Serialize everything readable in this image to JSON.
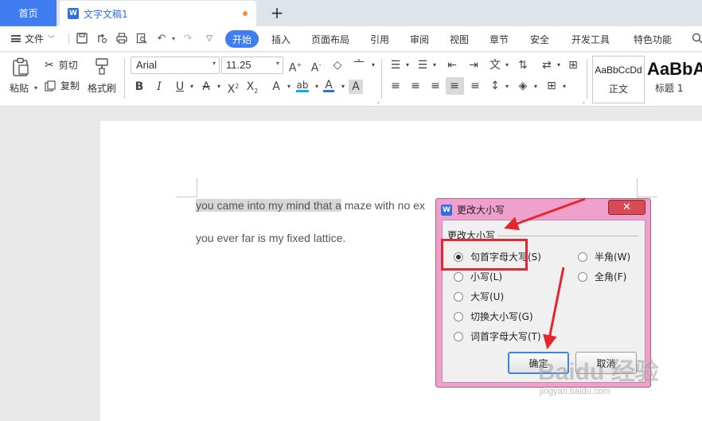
{
  "tabs": {
    "home": "首页",
    "doc_title": "文字文稿1",
    "add": "+"
  },
  "menubar": {
    "file": "文件",
    "items": [
      "插入",
      "页面布局",
      "引用",
      "审阅",
      "视图",
      "章节",
      "安全",
      "开发工具",
      "特色功能"
    ],
    "active": "开始"
  },
  "ribbon": {
    "paste": "粘贴",
    "cut": "剪切",
    "copy": "复制",
    "format_painter": "格式刷",
    "font_name": "Arial",
    "font_size": "11.25",
    "style_normal_sample": "AaBbCcDd",
    "style_normal_name": "正文",
    "style_heading_sample": "AaBbA",
    "style_heading_name": "标题 1"
  },
  "document": {
    "line1_selected": "you came into my mind that a",
    "line1_rest": " maze with no ex",
    "line2": "you ever far is my fixed lattice."
  },
  "dialog": {
    "title": "更改大小写",
    "close": "✕",
    "group_label": "更改大小写",
    "options_left": [
      {
        "label": "句首字母大写(S)",
        "checked": true
      },
      {
        "label": "小写(L)",
        "checked": false
      },
      {
        "label": "大写(U)",
        "checked": false
      },
      {
        "label": "切换大小写(G)",
        "checked": false
      },
      {
        "label": "词首字母大写(T)",
        "checked": false
      }
    ],
    "options_right": [
      {
        "label": "半角(W)",
        "checked": false
      },
      {
        "label": "全角(F)",
        "checked": false
      }
    ],
    "ok": "确定",
    "cancel": "取消"
  },
  "watermark": {
    "main": "Baidu 经验",
    "sub": "jingyan.baidu.com"
  },
  "colors": {
    "accent": "#3f7df0",
    "dialog_frame": "#f0a0cc",
    "annotation_red": "#e2282d"
  }
}
